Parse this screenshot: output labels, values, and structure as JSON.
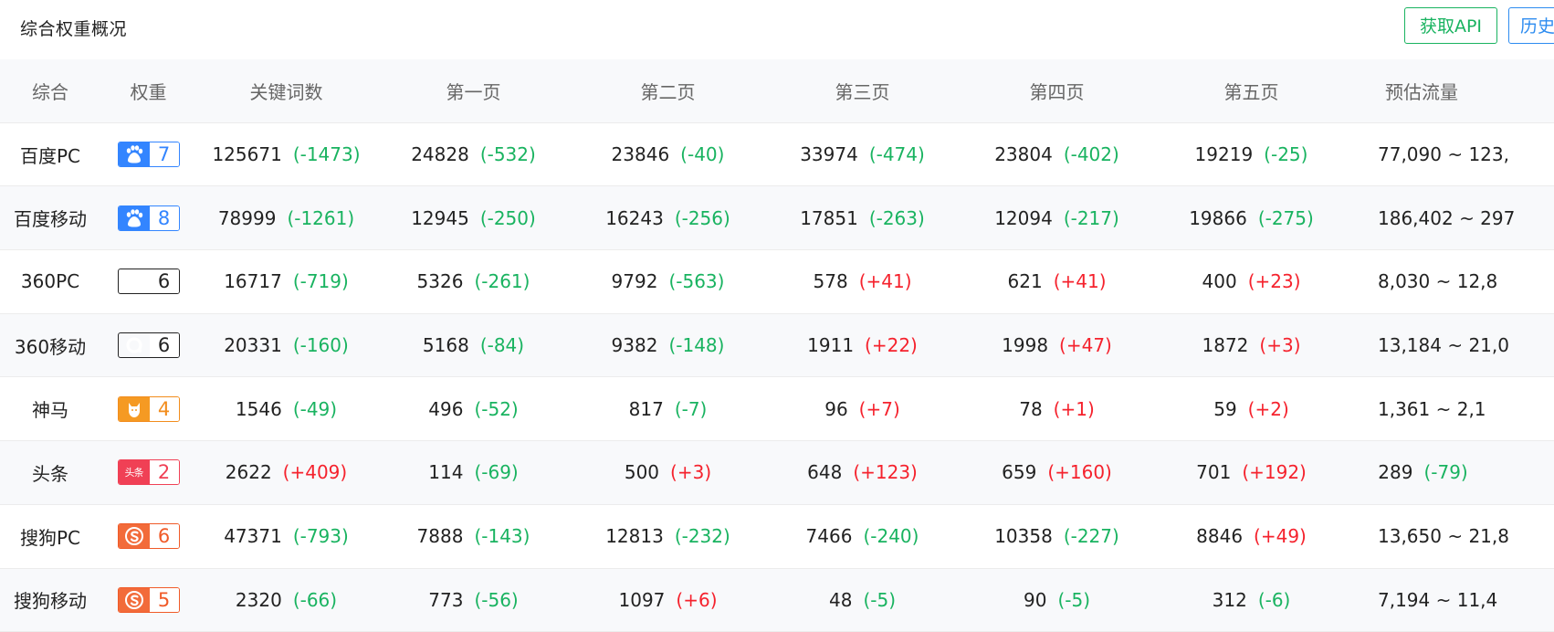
{
  "header": {
    "title": "综合权重概况",
    "api_button": "获取API",
    "history_button": "历史"
  },
  "columns": [
    "综合",
    "权重",
    "关键词数",
    "第一页",
    "第二页",
    "第三页",
    "第四页",
    "第五页",
    "预估流量"
  ],
  "colors": {
    "decrease": "#19b360",
    "increase": "#f5222d",
    "baidu": "#3385ff",
    "so360": "#27c24c",
    "shenma": "#f28c1c",
    "toutiao": "#f04055",
    "sogou": "#f05a28"
  },
  "rows": [
    {
      "engine": "百度PC",
      "icon": "baidu-pc-icon",
      "badge_type": "baidu",
      "weight": "7",
      "cells": [
        [
          "125671",
          "(-1473)"
        ],
        [
          "24828",
          "(-532)"
        ],
        [
          "23846",
          "(-40)"
        ],
        [
          "33974",
          "(-474)"
        ],
        [
          "23804",
          "(-402)"
        ],
        [
          "19219",
          "(-25)"
        ]
      ],
      "traffic": "77,090 ~ 123,",
      "traffic_delta": ""
    },
    {
      "engine": "百度移动",
      "icon": "baidu-mobile-icon",
      "badge_type": "baidu",
      "weight": "8",
      "cells": [
        [
          "78999",
          "(-1261)"
        ],
        [
          "12945",
          "(-250)"
        ],
        [
          "16243",
          "(-256)"
        ],
        [
          "17851",
          "(-263)"
        ],
        [
          "12094",
          "(-217)"
        ],
        [
          "19866",
          "(-275)"
        ]
      ],
      "traffic": "186,402 ~ 297",
      "traffic_delta": ""
    },
    {
      "engine": "360PC",
      "icon": "so360-icon",
      "badge_type": "so360",
      "weight": "6",
      "cells": [
        [
          "16717",
          "(-719)"
        ],
        [
          "5326",
          "(-261)"
        ],
        [
          "9792",
          "(-563)"
        ],
        [
          "578",
          "(+41)"
        ],
        [
          "621",
          "(+41)"
        ],
        [
          "400",
          "(+23)"
        ]
      ],
      "traffic": "8,030 ~ 12,8",
      "traffic_delta": ""
    },
    {
      "engine": "360移动",
      "icon": "so360-icon",
      "badge_type": "so360",
      "weight": "6",
      "cells": [
        [
          "20331",
          "(-160)"
        ],
        [
          "5168",
          "(-84)"
        ],
        [
          "9382",
          "(-148)"
        ],
        [
          "1911",
          "(+22)"
        ],
        [
          "1998",
          "(+47)"
        ],
        [
          "1872",
          "(+3)"
        ]
      ],
      "traffic": "13,184 ~ 21,0",
      "traffic_delta": ""
    },
    {
      "engine": "神马",
      "icon": "shenma-icon",
      "badge_type": "sm",
      "weight": "4",
      "cells": [
        [
          "1546",
          "(-49)"
        ],
        [
          "496",
          "(-52)"
        ],
        [
          "817",
          "(-7)"
        ],
        [
          "96",
          "(+7)"
        ],
        [
          "78",
          "(+1)"
        ],
        [
          "59",
          "(+2)"
        ]
      ],
      "traffic": "1,361 ~ 2,1",
      "traffic_delta": ""
    },
    {
      "engine": "头条",
      "icon": "toutiao-icon",
      "badge_type": "tt",
      "weight": "2",
      "cells": [
        [
          "2622",
          "(+409)"
        ],
        [
          "114",
          "(-69)"
        ],
        [
          "500",
          "(+3)"
        ],
        [
          "648",
          "(+123)"
        ],
        [
          "659",
          "(+160)"
        ],
        [
          "701",
          "(+192)"
        ]
      ],
      "traffic": "289",
      "traffic_delta": "(-79)"
    },
    {
      "engine": "搜狗PC",
      "icon": "sogou-icon",
      "badge_type": "sg",
      "weight": "6",
      "cells": [
        [
          "47371",
          "(-793)"
        ],
        [
          "7888",
          "(-143)"
        ],
        [
          "12813",
          "(-232)"
        ],
        [
          "7466",
          "(-240)"
        ],
        [
          "10358",
          "(-227)"
        ],
        [
          "8846",
          "(+49)"
        ]
      ],
      "traffic": "13,650 ~ 21,8",
      "traffic_delta": ""
    },
    {
      "engine": "搜狗移动",
      "icon": "sogou-icon",
      "badge_type": "sg",
      "weight": "5",
      "cells": [
        [
          "2320",
          "(-66)"
        ],
        [
          "773",
          "(-56)"
        ],
        [
          "1097",
          "(+6)"
        ],
        [
          "48",
          "(-5)"
        ],
        [
          "90",
          "(-5)"
        ],
        [
          "312",
          "(-6)"
        ]
      ],
      "traffic": "7,194 ~ 11,4",
      "traffic_delta": ""
    }
  ],
  "toutiao_logo_text": "头条"
}
